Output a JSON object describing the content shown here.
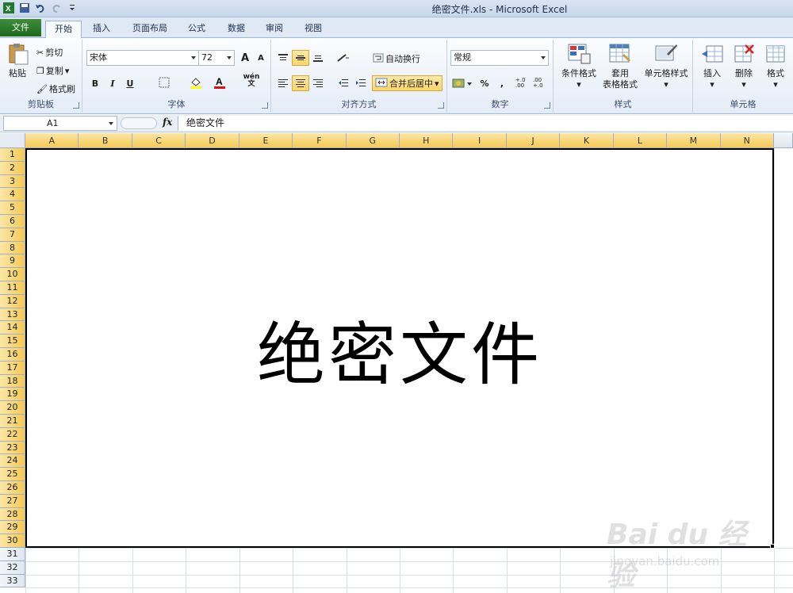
{
  "window": {
    "title": "绝密文件.xls  -  Microsoft Excel"
  },
  "tabs": [
    "文件",
    "开始",
    "插入",
    "页面布局",
    "公式",
    "数据",
    "审阅",
    "视图"
  ],
  "ribbon": {
    "clipboard": {
      "label": "剪贴板",
      "paste": "粘贴",
      "cut": "剪切",
      "copy": "复制",
      "format_painter": "格式刷"
    },
    "font": {
      "label": "字体",
      "name": "宋体",
      "size": "72",
      "grow": "A",
      "shrink": "A",
      "bold": "B",
      "italic": "I",
      "underline": "U",
      "phonetic": "wén",
      "phonetic2": "文"
    },
    "alignment": {
      "label": "对齐方式",
      "wrap": "自动换行",
      "merge": "合并后居中"
    },
    "number": {
      "label": "数字",
      "format": "常规",
      "percent": "%",
      "comma": ",",
      "inc": "+.0 .00",
      "dec": ".00 +.0"
    },
    "styles": {
      "label": "样式",
      "conditional": "条件格式",
      "table1": "套用",
      "table2": "表格格式",
      "cell_styles": "单元格样式"
    },
    "cells": {
      "label": "单元格",
      "insert": "插入",
      "delete": "删除",
      "format": "格式"
    }
  },
  "formula_bar": {
    "name_box": "A1",
    "fx": "fx",
    "content": "绝密文件"
  },
  "columns": [
    "A",
    "B",
    "C",
    "D",
    "E",
    "F",
    "G",
    "H",
    "I",
    "J",
    "K",
    "L",
    "M",
    "N"
  ],
  "rows": [
    "1",
    "2",
    "3",
    "4",
    "5",
    "6",
    "7",
    "8",
    "9",
    "10",
    "11",
    "12",
    "13",
    "14",
    "15",
    "16",
    "17",
    "18",
    "19",
    "20",
    "21",
    "22",
    "23",
    "24",
    "25",
    "26",
    "27",
    "28",
    "29",
    "30",
    "31",
    "32",
    "33"
  ],
  "merged_cell": {
    "text": "绝密文件"
  },
  "watermark": {
    "brand": "Bai du 经验",
    "url": "jingyan.baidu.com"
  }
}
